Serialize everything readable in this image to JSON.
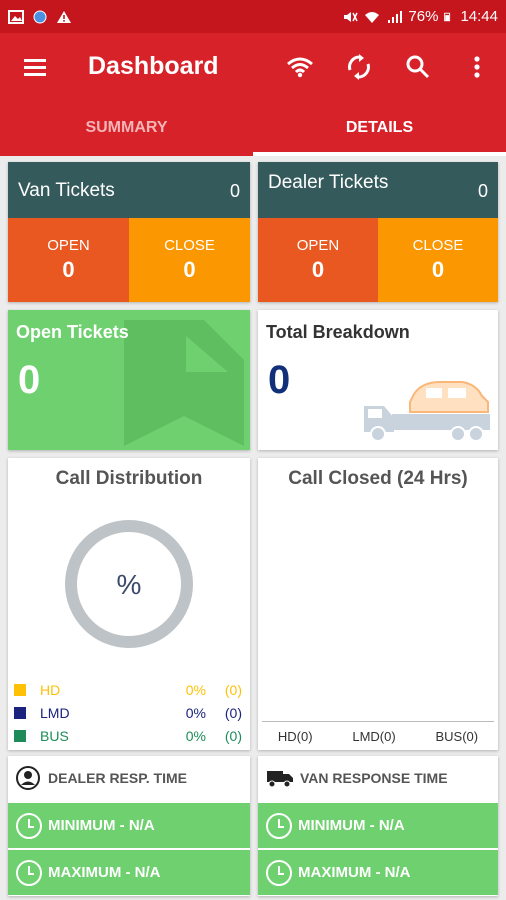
{
  "status_bar": {
    "battery": "76%",
    "time": "14:44"
  },
  "app_bar": {
    "title": "Dashboard"
  },
  "tabs": [
    {
      "label": "SUMMARY"
    },
    {
      "label": "DETAILS"
    }
  ],
  "van_tickets": {
    "title": "Van Tickets",
    "count": "0",
    "open_label": "OPEN",
    "open_value": "0",
    "close_label": "CLOSE",
    "close_value": "0"
  },
  "dealer_tickets": {
    "title": "Dealer Tickets",
    "count": "0",
    "open_label": "OPEN",
    "open_value": "0",
    "close_label": "CLOSE",
    "close_value": "0"
  },
  "open_tickets": {
    "title": "Open Tickets",
    "value": "0"
  },
  "total_breakdown": {
    "title": "Total Breakdown",
    "value": "0"
  },
  "call_distribution": {
    "title": "Call Distribution",
    "center": "%",
    "legend": [
      {
        "name": "HD",
        "percent": "0%",
        "count": "(0)",
        "color": "#ffc107"
      },
      {
        "name": "LMD",
        "percent": "0%",
        "count": "(0)",
        "color": "#1a237e"
      },
      {
        "name": "BUS",
        "percent": "0%",
        "count": "(0)",
        "color": "#1e8c5a"
      }
    ]
  },
  "call_closed": {
    "title": "Call Closed (24 Hrs)",
    "bars": [
      {
        "label": "HD(0)"
      },
      {
        "label": "LMD(0)"
      },
      {
        "label": "BUS(0)"
      }
    ]
  },
  "dealer_resp": {
    "title": "DEALER RESP. TIME",
    "minimum": "MINIMUM  - N/A",
    "maximum": "MAXIMUM  - N/A"
  },
  "van_resp": {
    "title": "VAN RESPONSE TIME",
    "minimum": "MINIMUM  - N/A",
    "maximum": "MAXIMUM  - N/A"
  },
  "colors": {
    "primary": "#d7222a",
    "status_bar": "#c4161c",
    "ticket_header": "#355a5c",
    "open": "#ea5822",
    "close": "#fb9700",
    "green": "#6fd06f",
    "navy": "#12307a"
  }
}
